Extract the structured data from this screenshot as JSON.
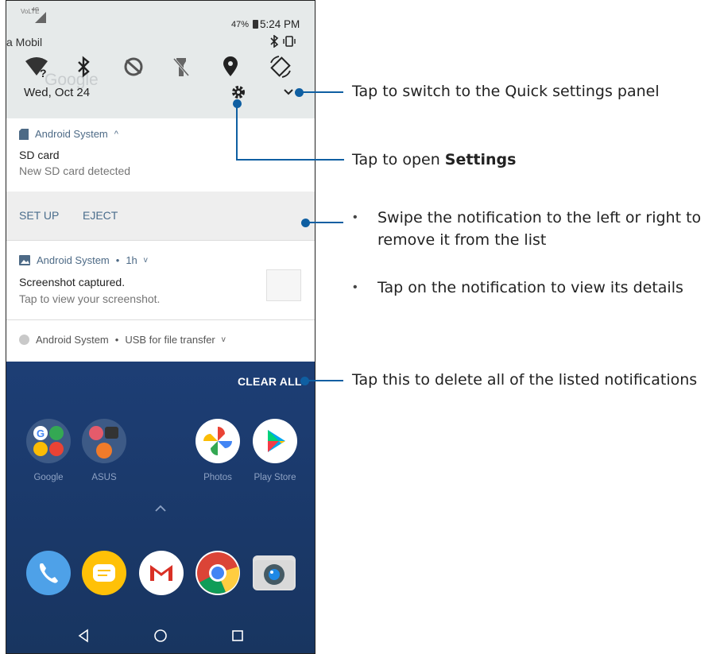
{
  "status_bar": {
    "battery_percent": "47%",
    "time": "5:24 PM",
    "carrier_partial": "a Mobil",
    "network_label": "4G"
  },
  "quick_settings": {
    "date": "Wed, Oct 24",
    "icons": [
      "wifi-icon",
      "bluetooth-icon",
      "data-saver-off-icon",
      "flashlight-off-icon",
      "location-icon",
      "auto-rotate-icon"
    ],
    "ghost_text": "Google"
  },
  "notifications": [
    {
      "app_name": "Android System",
      "title": "SD card",
      "text": "New SD card detected",
      "actions": [
        "SET UP",
        "EJECT"
      ]
    },
    {
      "app_name": "Android System",
      "time": "1h",
      "title": "Screenshot captured.",
      "text": "Tap to view your screenshot."
    },
    {
      "app_name": "Android System",
      "summary": "USB for file transfer"
    }
  ],
  "home": {
    "clear_all": "CLEAR ALL",
    "apps": [
      {
        "label": "Google"
      },
      {
        "label": "ASUS"
      },
      {
        "label": "Photos"
      },
      {
        "label": "Play Store"
      }
    ],
    "dock": [
      "phone-icon",
      "messages-icon",
      "gmail-icon",
      "chrome-icon",
      "camera-icon"
    ],
    "nav": [
      "back-icon",
      "home-icon",
      "recents-icon"
    ]
  },
  "callouts": {
    "quick_settings": "Tap to switch to the Quick settings panel",
    "settings_prefix": "Tap to open ",
    "settings_bold": "Settings",
    "swipe": "Swipe the notification to the left or right to remove it from the list",
    "tap_details": "Tap on the notification to view its details",
    "clear_all": "Tap this to delete all of the listed notifications"
  },
  "colors": {
    "callout_line": "#0f5fa2",
    "action_text": "#4a6d8c",
    "home_background": "#1d3e75"
  }
}
